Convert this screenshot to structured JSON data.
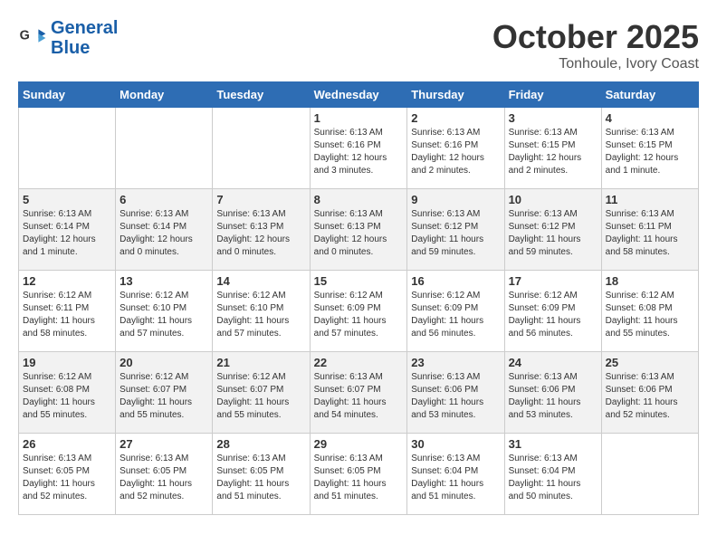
{
  "header": {
    "logo_line1": "General",
    "logo_line2": "Blue",
    "month": "October 2025",
    "location": "Tonhoule, Ivory Coast"
  },
  "days_of_week": [
    "Sunday",
    "Monday",
    "Tuesday",
    "Wednesday",
    "Thursday",
    "Friday",
    "Saturday"
  ],
  "weeks": [
    [
      {
        "day": "",
        "info": ""
      },
      {
        "day": "",
        "info": ""
      },
      {
        "day": "",
        "info": ""
      },
      {
        "day": "1",
        "info": "Sunrise: 6:13 AM\nSunset: 6:16 PM\nDaylight: 12 hours and 3 minutes."
      },
      {
        "day": "2",
        "info": "Sunrise: 6:13 AM\nSunset: 6:16 PM\nDaylight: 12 hours and 2 minutes."
      },
      {
        "day": "3",
        "info": "Sunrise: 6:13 AM\nSunset: 6:15 PM\nDaylight: 12 hours and 2 minutes."
      },
      {
        "day": "4",
        "info": "Sunrise: 6:13 AM\nSunset: 6:15 PM\nDaylight: 12 hours and 1 minute."
      }
    ],
    [
      {
        "day": "5",
        "info": "Sunrise: 6:13 AM\nSunset: 6:14 PM\nDaylight: 12 hours and 1 minute."
      },
      {
        "day": "6",
        "info": "Sunrise: 6:13 AM\nSunset: 6:14 PM\nDaylight: 12 hours and 0 minutes."
      },
      {
        "day": "7",
        "info": "Sunrise: 6:13 AM\nSunset: 6:13 PM\nDaylight: 12 hours and 0 minutes."
      },
      {
        "day": "8",
        "info": "Sunrise: 6:13 AM\nSunset: 6:13 PM\nDaylight: 12 hours and 0 minutes."
      },
      {
        "day": "9",
        "info": "Sunrise: 6:13 AM\nSunset: 6:12 PM\nDaylight: 11 hours and 59 minutes."
      },
      {
        "day": "10",
        "info": "Sunrise: 6:13 AM\nSunset: 6:12 PM\nDaylight: 11 hours and 59 minutes."
      },
      {
        "day": "11",
        "info": "Sunrise: 6:13 AM\nSunset: 6:11 PM\nDaylight: 11 hours and 58 minutes."
      }
    ],
    [
      {
        "day": "12",
        "info": "Sunrise: 6:12 AM\nSunset: 6:11 PM\nDaylight: 11 hours and 58 minutes."
      },
      {
        "day": "13",
        "info": "Sunrise: 6:12 AM\nSunset: 6:10 PM\nDaylight: 11 hours and 57 minutes."
      },
      {
        "day": "14",
        "info": "Sunrise: 6:12 AM\nSunset: 6:10 PM\nDaylight: 11 hours and 57 minutes."
      },
      {
        "day": "15",
        "info": "Sunrise: 6:12 AM\nSunset: 6:09 PM\nDaylight: 11 hours and 57 minutes."
      },
      {
        "day": "16",
        "info": "Sunrise: 6:12 AM\nSunset: 6:09 PM\nDaylight: 11 hours and 56 minutes."
      },
      {
        "day": "17",
        "info": "Sunrise: 6:12 AM\nSunset: 6:09 PM\nDaylight: 11 hours and 56 minutes."
      },
      {
        "day": "18",
        "info": "Sunrise: 6:12 AM\nSunset: 6:08 PM\nDaylight: 11 hours and 55 minutes."
      }
    ],
    [
      {
        "day": "19",
        "info": "Sunrise: 6:12 AM\nSunset: 6:08 PM\nDaylight: 11 hours and 55 minutes."
      },
      {
        "day": "20",
        "info": "Sunrise: 6:12 AM\nSunset: 6:07 PM\nDaylight: 11 hours and 55 minutes."
      },
      {
        "day": "21",
        "info": "Sunrise: 6:12 AM\nSunset: 6:07 PM\nDaylight: 11 hours and 55 minutes."
      },
      {
        "day": "22",
        "info": "Sunrise: 6:13 AM\nSunset: 6:07 PM\nDaylight: 11 hours and 54 minutes."
      },
      {
        "day": "23",
        "info": "Sunrise: 6:13 AM\nSunset: 6:06 PM\nDaylight: 11 hours and 53 minutes."
      },
      {
        "day": "24",
        "info": "Sunrise: 6:13 AM\nSunset: 6:06 PM\nDaylight: 11 hours and 53 minutes."
      },
      {
        "day": "25",
        "info": "Sunrise: 6:13 AM\nSunset: 6:06 PM\nDaylight: 11 hours and 52 minutes."
      }
    ],
    [
      {
        "day": "26",
        "info": "Sunrise: 6:13 AM\nSunset: 6:05 PM\nDaylight: 11 hours and 52 minutes."
      },
      {
        "day": "27",
        "info": "Sunrise: 6:13 AM\nSunset: 6:05 PM\nDaylight: 11 hours and 52 minutes."
      },
      {
        "day": "28",
        "info": "Sunrise: 6:13 AM\nSunset: 6:05 PM\nDaylight: 11 hours and 51 minutes."
      },
      {
        "day": "29",
        "info": "Sunrise: 6:13 AM\nSunset: 6:05 PM\nDaylight: 11 hours and 51 minutes."
      },
      {
        "day": "30",
        "info": "Sunrise: 6:13 AM\nSunset: 6:04 PM\nDaylight: 11 hours and 51 minutes."
      },
      {
        "day": "31",
        "info": "Sunrise: 6:13 AM\nSunset: 6:04 PM\nDaylight: 11 hours and 50 minutes."
      },
      {
        "day": "",
        "info": ""
      }
    ]
  ]
}
